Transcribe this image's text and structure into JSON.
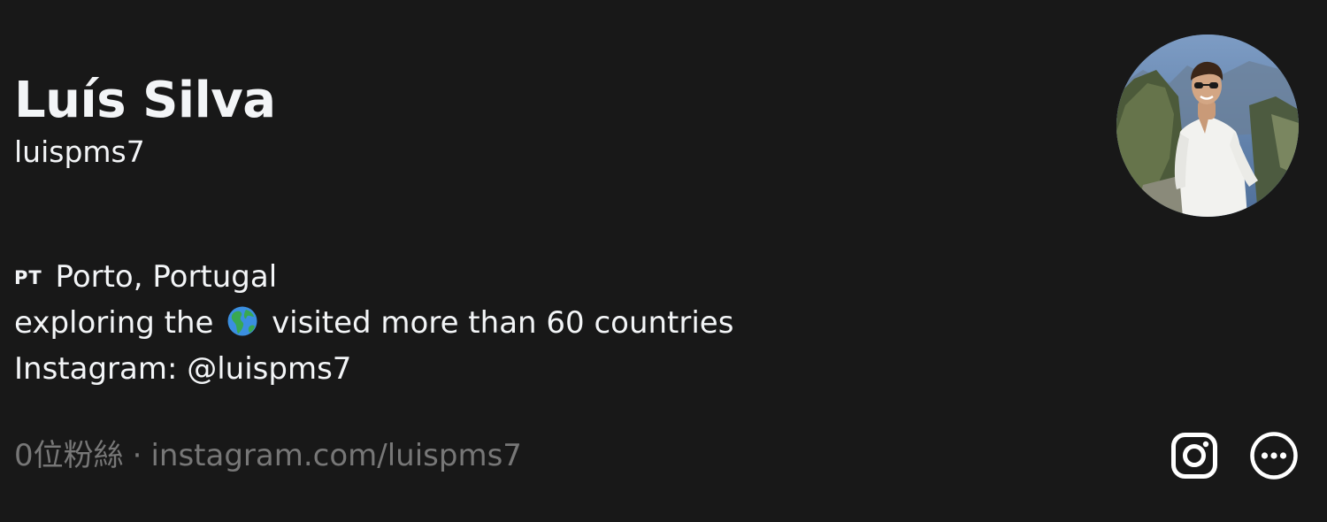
{
  "profile": {
    "name": "Luís Silva",
    "username": "luispms7",
    "bio": {
      "country_code": "PT",
      "location": "Porto, Portugal",
      "line2_before": "exploring the",
      "line2_icon": "globe-americas-icon",
      "line2_after": "visited more than 60 countries",
      "line3": "Instagram: @luispms7"
    },
    "followers": "0位粉絲",
    "separator": "·",
    "link": "instagram.com/luispms7",
    "avatar_alt": "profile photo"
  },
  "actions": {
    "instagram_icon": "instagram-icon",
    "more_icon": "more-options-icon"
  },
  "colors": {
    "background": "#181818",
    "text_primary": "#f3f5f7",
    "text_secondary": "#777777"
  }
}
